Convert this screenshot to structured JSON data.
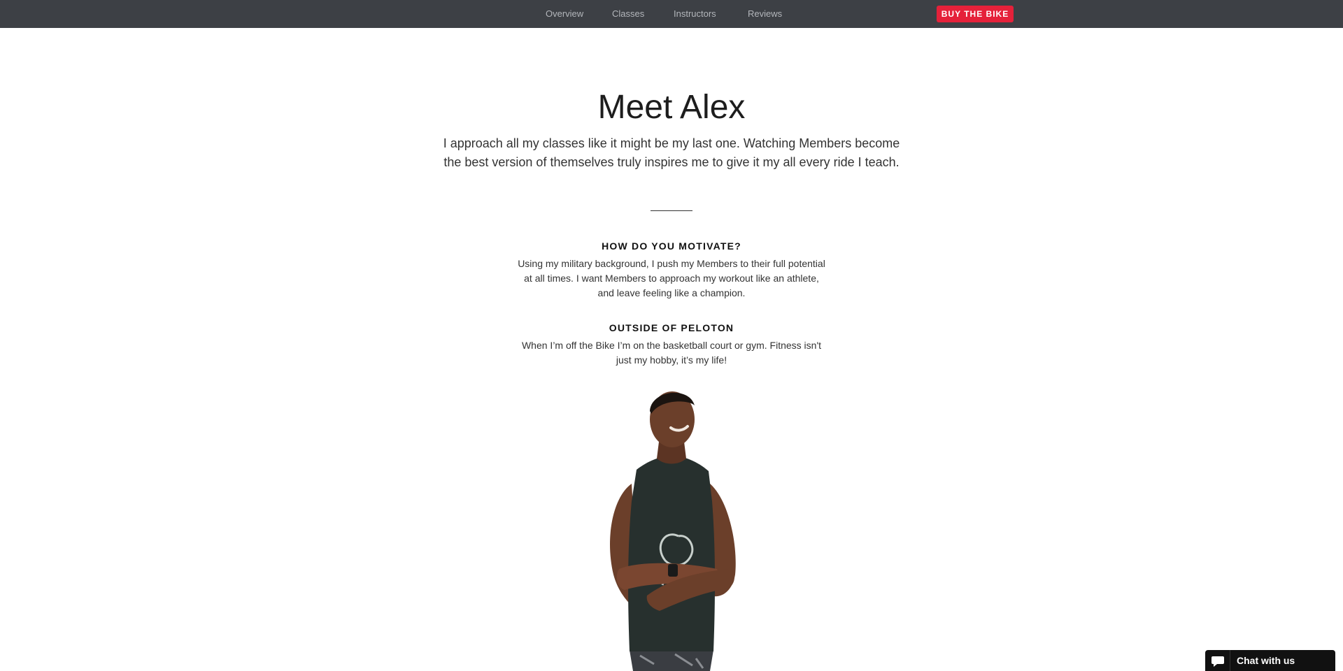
{
  "nav": {
    "items": [
      {
        "label": "Overview"
      },
      {
        "label": "Classes"
      },
      {
        "label": "Instructors"
      },
      {
        "label": "Reviews"
      }
    ],
    "cta_label": "BUY THE BIKE"
  },
  "main": {
    "title": "Meet Alex",
    "intro": "I approach all my classes like it might be my last one. Watching Members become the best version of themselves truly inspires me to give it my all every ride I teach.",
    "sections": [
      {
        "heading": "HOW DO YOU MOTIVATE?",
        "body": "Using my military background, I push my Members to their full potential at all times. I want Members to approach my workout like an athlete, and leave feeling like a champion."
      },
      {
        "heading": "OUTSIDE OF PELOTON",
        "body": "When I’m off the Bike I’m on the basketball court or gym. Fitness isn't just my hobby, it’s my life!"
      }
    ]
  },
  "chat": {
    "label": "Chat with us",
    "icon": "speech-bubble-icon"
  },
  "colors": {
    "nav_bg": "#3d4045",
    "nav_text": "#b3b6bb",
    "accent": "#e5213a",
    "chat_bg": "#111111"
  }
}
